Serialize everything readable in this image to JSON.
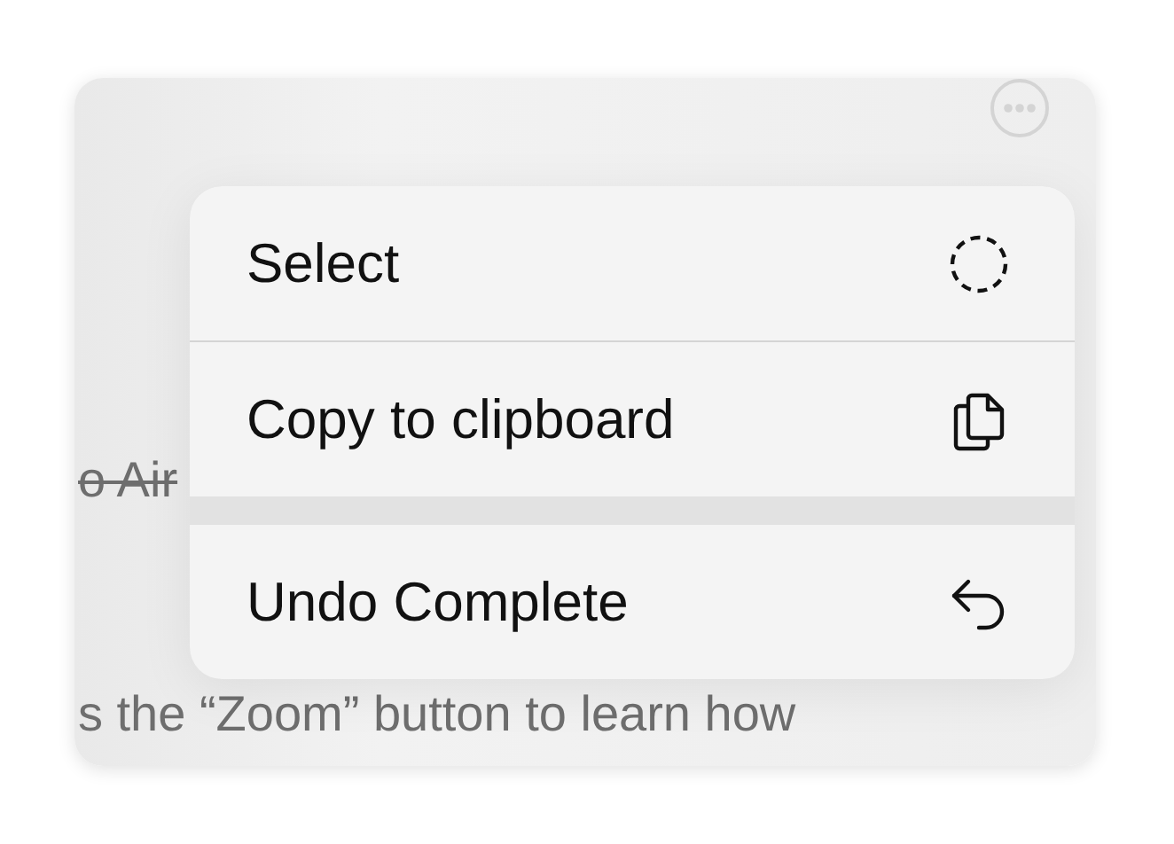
{
  "background_card": {
    "lines": [
      {
        "text": "o Air",
        "struck": true
      },
      {
        "text": "s the “Zoom” button to learn how",
        "struck": false
      }
    ]
  },
  "context_menu": {
    "sections": [
      [
        {
          "label": "Select"
        },
        {
          "label": "Copy to clipboard"
        }
      ],
      [
        {
          "label": "Undo Complete"
        }
      ]
    ]
  }
}
